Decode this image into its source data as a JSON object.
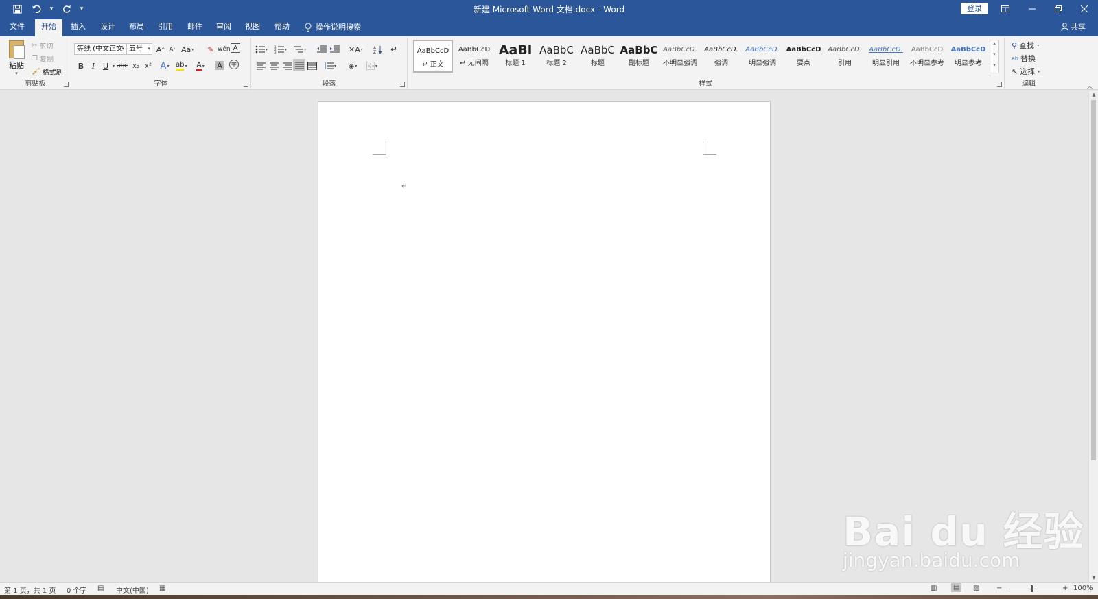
{
  "app": {
    "title": "新建 Microsoft Word 文档.docx  -  Word",
    "login_label": "登录"
  },
  "qat": {
    "save_icon": "save-icon",
    "undo_icon": "undo-icon",
    "redo_icon": "redo-icon",
    "customize_icon": "customize-qat-icon"
  },
  "tabs": [
    {
      "id": "file",
      "label": "文件"
    },
    {
      "id": "home",
      "label": "开始"
    },
    {
      "id": "insert",
      "label": "插入"
    },
    {
      "id": "design",
      "label": "设计"
    },
    {
      "id": "layout",
      "label": "布局"
    },
    {
      "id": "references",
      "label": "引用"
    },
    {
      "id": "mailings",
      "label": "邮件"
    },
    {
      "id": "review",
      "label": "审阅"
    },
    {
      "id": "view",
      "label": "视图"
    },
    {
      "id": "help",
      "label": "帮助"
    }
  ],
  "tell_me": "操作说明搜索",
  "share": "共享",
  "clipboard": {
    "label": "剪贴板",
    "paste": "粘贴",
    "cut": "剪切",
    "copy": "复制",
    "format_painter": "格式刷"
  },
  "font": {
    "label": "字体",
    "font_name": "等线 (中文正文",
    "font_size": "五号",
    "grow": "A",
    "shrink": "A",
    "case": "Aa",
    "bold": "B",
    "italic": "I",
    "underline": "U",
    "strike": "abc",
    "subscript": "x₂",
    "superscript": "x²",
    "text_effect": "A",
    "font_color": "A",
    "char_shading": "A",
    "enclose": "字"
  },
  "paragraph": {
    "label": "段落"
  },
  "styles": {
    "label": "样式",
    "items": [
      {
        "sample": "AaBbCcD",
        "name": "↵ 正文"
      },
      {
        "sample": "AaBbCcD",
        "name": "↵ 无间隔"
      },
      {
        "sample": "AaBl",
        "name": "标题 1"
      },
      {
        "sample": "AaBbC",
        "name": "标题 2"
      },
      {
        "sample": "AaBbC",
        "name": "标题"
      },
      {
        "sample": "AaBbC",
        "name": "副标题"
      },
      {
        "sample": "AaBbCcD.",
        "name": "不明显强调"
      },
      {
        "sample": "AaBbCcD.",
        "name": "强调"
      },
      {
        "sample": "AaBbCcD.",
        "name": "明显强调"
      },
      {
        "sample": "AaBbCcD",
        "name": "要点"
      },
      {
        "sample": "AaBbCcD.",
        "name": "引用"
      },
      {
        "sample": "AaBbCcD.",
        "name": "明显引用"
      },
      {
        "sample": "AaBbCcD",
        "name": "不明显参考"
      },
      {
        "sample": "AaBbCcD",
        "name": "明显参考"
      }
    ]
  },
  "editing": {
    "label": "编辑",
    "find": "查找",
    "replace": "替换",
    "select": "选择"
  },
  "document": {
    "paragraph_mark": "↵"
  },
  "status": {
    "page": "第 1 页，共 1 页",
    "words": "0 个字",
    "language": "中文(中国)",
    "zoom": "100%"
  },
  "watermark": {
    "brand": "Bai du 经验",
    "url": "jingyan.baidu.com"
  },
  "colors": {
    "accent": "#2b579a",
    "ribbon": "#f3f3f3",
    "canvas": "#e6e6e6"
  }
}
